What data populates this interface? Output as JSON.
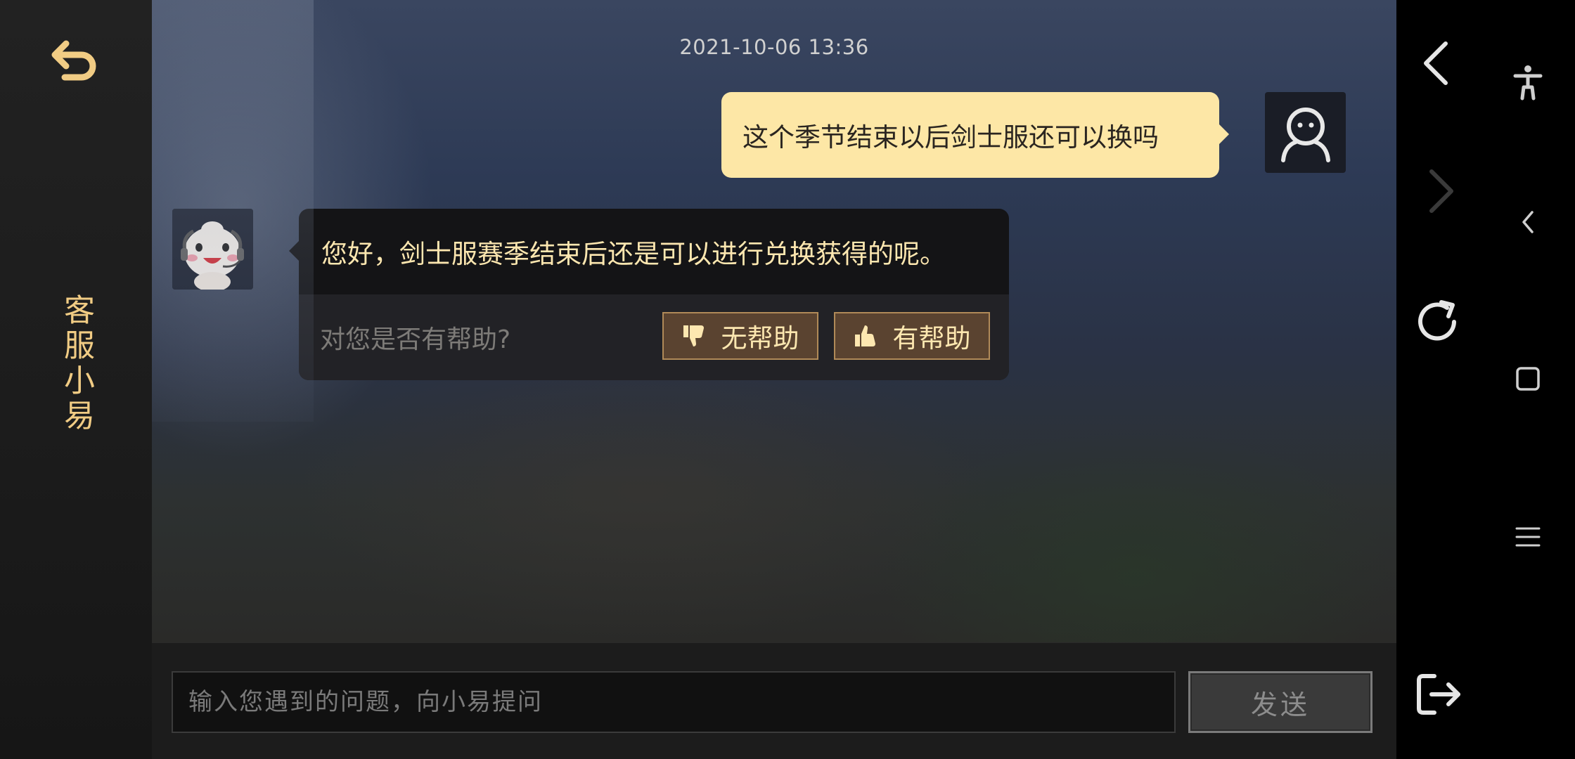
{
  "sidebar": {
    "back_icon": "return-arrow-icon",
    "title": "客服小易",
    "accent_color": "#f1cc84"
  },
  "chat": {
    "timestamp": "2021-10-06 13:36",
    "user_message": {
      "text": "这个季节结束以后剑士服还可以换吗",
      "avatar_icon": "user-face-icon"
    },
    "bot_message": {
      "text": "您好，剑士服赛季结束后还是可以进行兑换获得的呢。",
      "avatar_icon": "mascot-avatar-icon",
      "feedback_question": "对您是否有帮助?",
      "not_helpful_label": "无帮助",
      "helpful_label": "有帮助"
    }
  },
  "input": {
    "placeholder": "输入您遇到的问题，向小易提问",
    "value": "",
    "send_label": "发送"
  },
  "browser_nav": {
    "back_icon": "chevron-left-icon",
    "forward_icon": "chevron-right-icon",
    "refresh_icon": "refresh-icon",
    "exit_icon": "exit-icon"
  },
  "system_nav": {
    "accessibility_icon": "accessibility-icon",
    "back_icon": "small-chevron-left-icon",
    "home_icon": "square-home-icon",
    "menu_icon": "hamburger-menu-icon"
  }
}
